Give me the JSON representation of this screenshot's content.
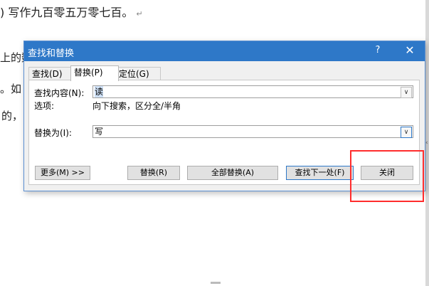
{
  "document": {
    "line1_text": ") 写作九百零五万零七百。",
    "line1_mark": "↵",
    "frag2": "上的数",
    "frag3": "。如",
    "frag4": "的，"
  },
  "dialog": {
    "title": "查找和替换",
    "help_label": "?",
    "close_icon": "✕",
    "tabs": [
      {
        "label": "查找(D)",
        "active": false
      },
      {
        "label": "替换(P)",
        "active": true
      },
      {
        "label": "定位(G)",
        "active": false
      }
    ],
    "find_label": "查找内容(N):",
    "find_value": "读",
    "options_label": "选项:",
    "options_value": "向下搜索，区分全/半角",
    "replace_label": "替换为(I):",
    "replace_value": "写",
    "dropdown_glyph": "∨",
    "buttons": {
      "more": "更多(M) >>",
      "replace": "替换(R)",
      "replace_all": "全部替换(A)",
      "find_next": "查找下一处(F)",
      "close": "关闭"
    }
  },
  "colors": {
    "titlebar": "#2e78c8",
    "highlight_border": "#ff2d2d"
  }
}
